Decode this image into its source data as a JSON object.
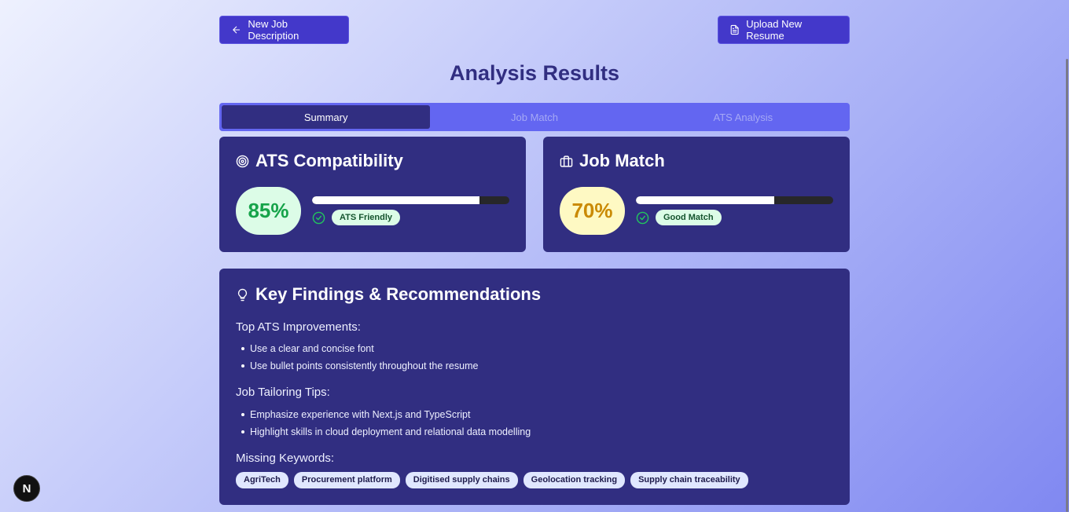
{
  "header": {
    "new_job_label": "New Job Description",
    "upload_label": "Upload New Resume",
    "title": "Analysis Results"
  },
  "tabs": [
    {
      "label": "Summary",
      "active": true
    },
    {
      "label": "Job Match",
      "active": false
    },
    {
      "label": "ATS Analysis",
      "active": false
    }
  ],
  "ats_card": {
    "title": "ATS Compatibility",
    "icon": "target-icon",
    "score": "85%",
    "progress": 0.85,
    "status_label": "ATS Friendly",
    "status_icon": "check-circle-icon"
  },
  "job_card": {
    "title": "Job Match",
    "icon": "briefcase-icon",
    "score": "70%",
    "progress": 0.7,
    "status_label": "Good Match",
    "status_icon": "check-circle-icon"
  },
  "findings": {
    "title": "Key Findings & Recommendations",
    "icon": "lightbulb-icon",
    "ats_label": "Top ATS Improvements:",
    "ats_items": [
      "Use a clear and concise font",
      "Use bullet points consistently throughout the resume"
    ],
    "tailoring_label": "Job Tailoring Tips:",
    "tailoring_items": [
      "Emphasize experience with Next.js and TypeScript",
      "Highlight skills in cloud deployment and relational data modelling"
    ],
    "keywords_label": "Missing Keywords:",
    "keywords": [
      "AgriTech",
      "Procurement platform",
      "Digitised supply chains",
      "Geolocation tracking",
      "Supply chain traceability"
    ]
  },
  "floating": {
    "next_badge": "N"
  },
  "colors": {
    "card_bg": "#312e81",
    "accent": "#4338ca",
    "tab_bar": "#6366f1",
    "success": "#16a34a",
    "warning": "#ca8a04"
  }
}
